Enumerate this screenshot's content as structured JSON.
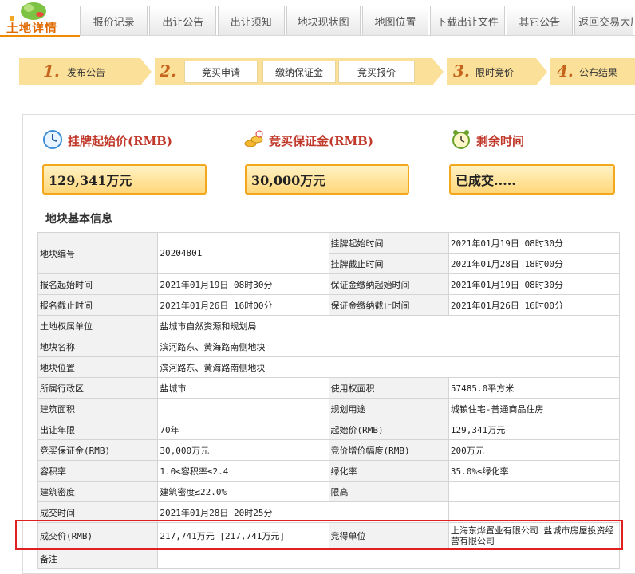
{
  "header": {
    "logo_text": "土地详情",
    "tabs": [
      "报价记录",
      "出让公告",
      "出让须知",
      "地块现状图",
      "地图位置",
      "下载出让文件",
      "其它公告",
      "返回交易大厅"
    ]
  },
  "steps": {
    "step1": {
      "num": "1.",
      "label": "发布公告"
    },
    "step2": {
      "num": "2.",
      "items": [
        "竞买申请",
        "缴纳保证金",
        "竞买报价"
      ]
    },
    "step3": {
      "num": "3.",
      "label": "限时竞价"
    },
    "step4": {
      "num": "4.",
      "label": "公布结果"
    }
  },
  "summary": {
    "start_price_title": "挂牌起始价(RMB)",
    "start_price_value": "129,341万元",
    "deposit_title": "竞买保证金(RMB)",
    "deposit_value": "30,000万元",
    "remaining_title": "剩余时间",
    "remaining_value": "已成交....."
  },
  "section_title": "地块基本信息",
  "table": {
    "r1": {
      "l1": "地块编号",
      "v1": "20204801",
      "l2": "挂牌起始时间",
      "v2": "2021年01月19日 08时30分"
    },
    "r2": {
      "l2": "挂牌截止时间",
      "v2": "2021年01月28日 18时00分"
    },
    "r3": {
      "l1": "报名起始时间",
      "v1": "2021年01月19日 08时30分",
      "l2": "保证金缴纳起始时间",
      "v2": "2021年01月19日 08时30分"
    },
    "r4": {
      "l1": "报名截止时间",
      "v1": "2021年01月26日 16时00分",
      "l2": "保证金缴纳截止时间",
      "v2": "2021年01月26日 16时00分"
    },
    "r5": {
      "l1": "土地权属单位",
      "v1": "盐城市自然资源和规划局"
    },
    "r6": {
      "l1": "地块名称",
      "v1": "滨河路东、黄海路南侧地块"
    },
    "r7": {
      "l1": "地块位置",
      "v1": "滨河路东、黄海路南侧地块"
    },
    "r8": {
      "l1": "所属行政区",
      "v1": "盐城市",
      "l2": "使用权面积",
      "v2": "57485.0平方米"
    },
    "r9": {
      "l1": "建筑面积",
      "v1": "",
      "l2": "规划用途",
      "v2": "城镇住宅-普通商品住房"
    },
    "r10": {
      "l1": "出让年限",
      "v1": "70年",
      "l2": "起始价(RMB)",
      "v2": "129,341万元"
    },
    "r11": {
      "l1": "竞买保证金(RMB)",
      "v1": "30,000万元",
      "l2": "竞价增价幅度(RMB)",
      "v2": "200万元"
    },
    "r12": {
      "l1": "容积率",
      "v1": "1.0<容积率≤2.4",
      "l2": "绿化率",
      "v2": "35.0%≤绿化率"
    },
    "r13": {
      "l1": "建筑密度",
      "v1": "建筑密度≤22.0%",
      "l2": "限高",
      "v2": ""
    },
    "r14": {
      "l1": "成交时间",
      "v1": "2021年01月28日 20时25分"
    },
    "r15": {
      "l1": "成交价(RMB)",
      "v1": "217,741万元 [217,741万元]",
      "l2": "竞得单位",
      "v2": "上海东烨置业有限公司 盐城市房屋投资经营有限公司"
    },
    "r16": {
      "l1": "备注",
      "v1": ""
    }
  },
  "colors": {
    "accent": "#f2a71e",
    "highlight": "#e02020",
    "title_red": "#c0392b"
  }
}
